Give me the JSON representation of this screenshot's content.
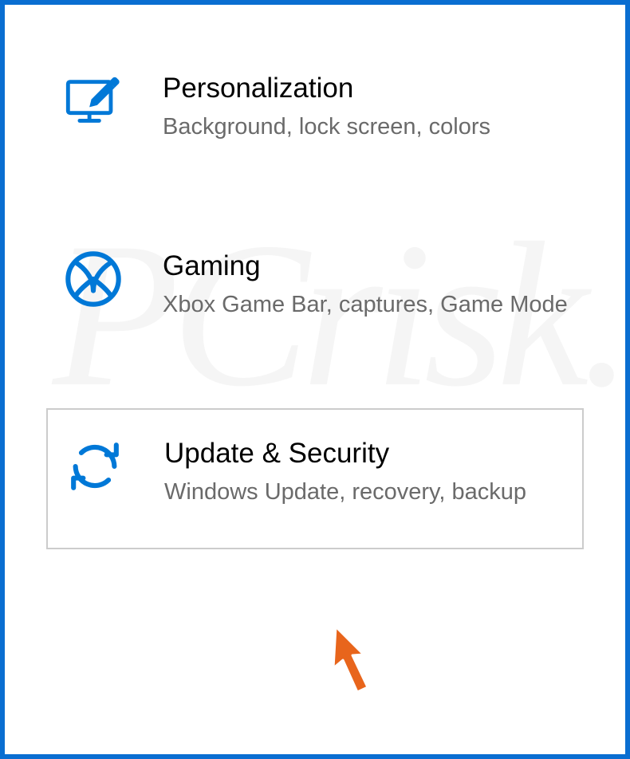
{
  "settings": {
    "items": [
      {
        "title": "Personalization",
        "description": "Background, lock screen, colors"
      },
      {
        "title": "Gaming",
        "description": "Xbox Game Bar, captures, Game Mode"
      },
      {
        "title": "Update & Security",
        "description": "Windows Update, recovery, backup"
      }
    ]
  },
  "watermark": "PCrisk.com"
}
